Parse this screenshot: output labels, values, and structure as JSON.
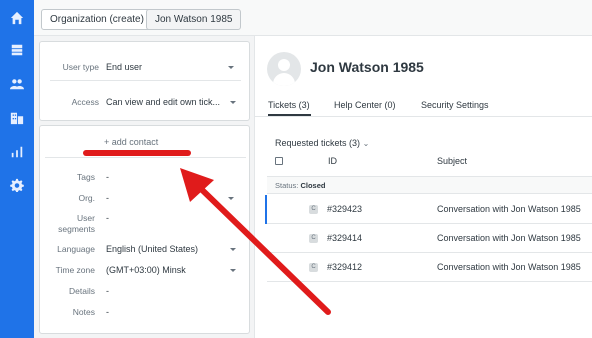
{
  "colors": {
    "rail": "#1f73e8",
    "annotation": "#e01b1b"
  },
  "nav": {
    "icons": [
      "home-icon",
      "views-icon",
      "customers-icon",
      "organizations-icon",
      "reporting-icon",
      "admin-icon"
    ]
  },
  "topbar": {
    "tab_organization": "Organization (create)",
    "tab_user": "Jon Watson 1985"
  },
  "user_card": {
    "user_type_label": "User type",
    "user_type_value": "End user",
    "access_label": "Access",
    "access_value": "Can view and edit own tick..."
  },
  "details_card": {
    "add_contact": "+ add contact",
    "tags_label": "Tags",
    "tags_value": "-",
    "org_label": "Org.",
    "org_value": "-",
    "segments_label_1": "User",
    "segments_label_2": "segments",
    "segments_value": "-",
    "language_label": "Language",
    "language_value": "English (United States)",
    "timezone_label": "Time zone",
    "timezone_value": "(GMT+03:00) Minsk",
    "details_label": "Details",
    "details_value": "-",
    "notes_label": "Notes",
    "notes_value": "-"
  },
  "profile": {
    "name": "Jon Watson 1985",
    "tabs": [
      "Tickets (3)",
      "Help Center (0)",
      "Security Settings"
    ]
  },
  "tickets": {
    "header": "Requested tickets (3)",
    "col_id": "ID",
    "col_subject": "Subject",
    "group_prefix": "Status:",
    "group_value": "Closed",
    "rows": [
      {
        "status": "C",
        "id": "#329423",
        "subject": "Conversation with Jon Watson 1985"
      },
      {
        "status": "C",
        "id": "#329414",
        "subject": "Conversation with Jon Watson 1985"
      },
      {
        "status": "C",
        "id": "#329412",
        "subject": "Conversation with Jon Watson 1985"
      }
    ]
  }
}
